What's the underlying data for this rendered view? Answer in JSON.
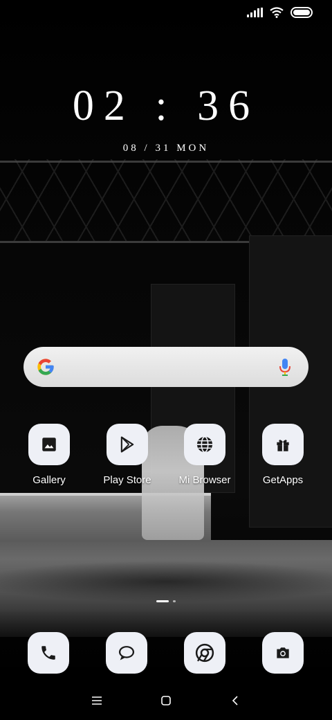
{
  "clock": {
    "time": "02 : 36",
    "date": "08 / 31  MON"
  },
  "search": {
    "google_icon": "google-g-icon",
    "mic_icon": "mic-icon",
    "colors": {
      "blue": "#4285F4",
      "red": "#EA4335",
      "yellow": "#FBBC05",
      "green": "#34A853"
    }
  },
  "apps": [
    {
      "label": "Gallery",
      "icon": "gallery-icon"
    },
    {
      "label": "Play Store",
      "icon": "play-store-icon"
    },
    {
      "label": "Mi Browser",
      "icon": "globe-icon"
    },
    {
      "label": "GetApps",
      "icon": "gift-icon"
    }
  ],
  "dock": [
    {
      "icon": "phone-icon"
    },
    {
      "icon": "messages-icon"
    },
    {
      "icon": "chrome-icon"
    },
    {
      "icon": "camera-icon"
    }
  ],
  "pages": {
    "count": 2,
    "current": 1
  },
  "nav": {
    "menu_icon": "menu-icon",
    "home_icon": "home-icon",
    "back_icon": "back-icon"
  }
}
